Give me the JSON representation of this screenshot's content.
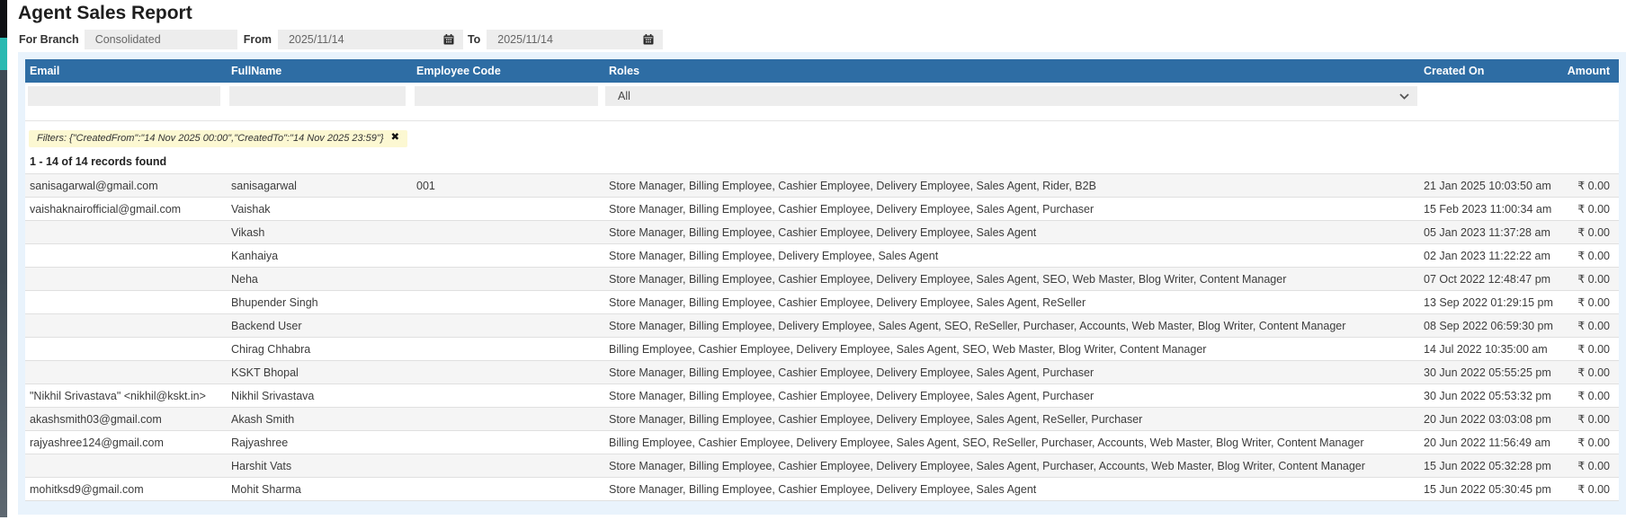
{
  "page": {
    "title": "Agent Sales Report"
  },
  "controls": {
    "branch_label": "For Branch",
    "branch_value": "Consolidated",
    "from_label": "From",
    "from_value": "2025/11/14",
    "to_label": "To",
    "to_value": "2025/11/14"
  },
  "table": {
    "columns": {
      "email": "Email",
      "fullname": "FullName",
      "employee_code": "Employee Code",
      "roles": "Roles",
      "created_on": "Created On",
      "amount": "Amount"
    },
    "roles_filter_value": "All",
    "filter_chip_text": "Filters: {\"CreatedFrom\":\"14 Nov 2025 00:00\",\"CreatedTo\":\"14 Nov 2025 23:59\"}",
    "chip_close_glyph": "✖",
    "records_summary": "1 - 14 of 14 records found",
    "rows": [
      {
        "email": "sanisagarwal@gmail.com",
        "fullname": "sanisagarwal",
        "employee_code": "001",
        "roles": "Store Manager, Billing Employee, Cashier Employee, Delivery Employee, Sales Agent, Rider, B2B",
        "created_on": "21 Jan 2025 10:03:50 am",
        "amount": "₹ 0.00"
      },
      {
        "email": "vaishaknairofficial@gmail.com",
        "fullname": "Vaishak",
        "employee_code": "",
        "roles": "Store Manager, Billing Employee, Cashier Employee, Delivery Employee, Sales Agent, Purchaser",
        "created_on": "15 Feb 2023 11:00:34 am",
        "amount": "₹ 0.00"
      },
      {
        "email": "",
        "fullname": "Vikash",
        "employee_code": "",
        "roles": "Store Manager, Billing Employee, Cashier Employee, Delivery Employee, Sales Agent",
        "created_on": "05 Jan 2023 11:37:28 am",
        "amount": "₹ 0.00"
      },
      {
        "email": "",
        "fullname": "Kanhaiya",
        "employee_code": "",
        "roles": "Store Manager, Billing Employee, Delivery Employee, Sales Agent",
        "created_on": "02 Jan 2023 11:22:22 am",
        "amount": "₹ 0.00"
      },
      {
        "email": "",
        "fullname": "Neha",
        "employee_code": "",
        "roles": "Store Manager, Billing Employee, Cashier Employee, Delivery Employee, Sales Agent, SEO, Web Master, Blog Writer, Content Manager",
        "created_on": "07 Oct 2022 12:48:47 pm",
        "amount": "₹ 0.00"
      },
      {
        "email": "",
        "fullname": "Bhupender Singh",
        "employee_code": "",
        "roles": "Store Manager, Billing Employee, Cashier Employee, Delivery Employee, Sales Agent, ReSeller",
        "created_on": "13 Sep 2022 01:29:15 pm",
        "amount": "₹ 0.00"
      },
      {
        "email": "",
        "fullname": "Backend User",
        "employee_code": "",
        "roles": "Store Manager, Billing Employee, Delivery Employee, Sales Agent, SEO, ReSeller, Purchaser, Accounts, Web Master, Blog Writer, Content Manager",
        "created_on": "08 Sep 2022 06:59:30 pm",
        "amount": "₹ 0.00"
      },
      {
        "email": "",
        "fullname": "Chirag Chhabra",
        "employee_code": "",
        "roles": "Billing Employee, Cashier Employee, Delivery Employee, Sales Agent, SEO, Web Master, Blog Writer, Content Manager",
        "created_on": "14 Jul 2022 10:35:00 am",
        "amount": "₹ 0.00"
      },
      {
        "email": "",
        "fullname": "KSKT Bhopal",
        "employee_code": "",
        "roles": "Store Manager, Billing Employee, Cashier Employee, Delivery Employee, Sales Agent, Purchaser",
        "created_on": "30 Jun 2022 05:55:25 pm",
        "amount": "₹ 0.00"
      },
      {
        "email": "\"Nikhil Srivastava\" <nikhil@kskt.in>",
        "fullname": "Nikhil Srivastava",
        "employee_code": "",
        "roles": "Store Manager, Billing Employee, Cashier Employee, Delivery Employee, Sales Agent, Purchaser",
        "created_on": "30 Jun 2022 05:53:32 pm",
        "amount": "₹ 0.00"
      },
      {
        "email": "akashsmith03@gmail.com",
        "fullname": "Akash Smith",
        "employee_code": "",
        "roles": "Store Manager, Billing Employee, Cashier Employee, Delivery Employee, Sales Agent, ReSeller, Purchaser",
        "created_on": "20 Jun 2022 03:03:08 pm",
        "amount": "₹ 0.00"
      },
      {
        "email": "rajyashree124@gmail.com",
        "fullname": "Rajyashree",
        "employee_code": "",
        "roles": "Billing Employee, Cashier Employee, Delivery Employee, Sales Agent, SEO, ReSeller, Purchaser, Accounts, Web Master, Blog Writer, Content Manager",
        "created_on": "20 Jun 2022 11:56:49 am",
        "amount": "₹ 0.00"
      },
      {
        "email": "",
        "fullname": "Harshit Vats",
        "employee_code": "",
        "roles": "Store Manager, Billing Employee, Cashier Employee, Delivery Employee, Sales Agent, Purchaser, Accounts, Web Master, Blog Writer, Content Manager",
        "created_on": "15 Jun 2022 05:32:28 pm",
        "amount": "₹ 0.00"
      },
      {
        "email": "mohitksd9@gmail.com",
        "fullname": "Mohit Sharma",
        "employee_code": "",
        "roles": "Store Manager, Billing Employee, Cashier Employee, Delivery Employee, Sales Agent",
        "created_on": "15 Jun 2022 05:30:45 pm",
        "amount": "₹ 0.00"
      }
    ]
  },
  "colors": {
    "header_bg": "#2e6da4",
    "panel_bg": "#e9f3fc",
    "chip_bg": "#fcf8d2",
    "input_bg": "#ededed",
    "stripe_bg": "#f5f5f5",
    "sidebar_teal": "#2ab9b1"
  }
}
